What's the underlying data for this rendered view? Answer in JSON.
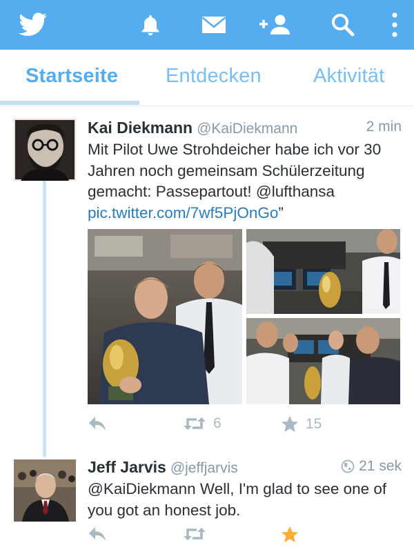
{
  "topbar": {
    "icons": [
      "twitter-bird-icon",
      "notifications-bell-icon",
      "messages-envelope-icon",
      "add-user-icon",
      "search-icon",
      "overflow-menu-icon"
    ],
    "color": "#55acee"
  },
  "tabs": [
    {
      "label": "Startseite",
      "active": true
    },
    {
      "label": "Entdecken",
      "active": false
    },
    {
      "label": "Aktivität",
      "active": false
    }
  ],
  "tweets": [
    {
      "name": "Kai Diekmann",
      "handle": "@KaiDiekmann",
      "time": "2 min",
      "text_lines": [
        "Mit Pilot Uwe Strohdeicher habe ich vor 30",
        "Jahren noch gemeinsam Schülerzeitung",
        "gemacht: Passepartout!  @lufthansa"
      ],
      "link": "pic.twitter.com/7wf5PjOnGo",
      "link_suffix": "”",
      "retweets": "6",
      "favorites": "15",
      "favorited": false
    },
    {
      "name": "Jeff Jarvis",
      "handle": "@jeffjarvis",
      "time": "21 sek",
      "text_lines": [
        "@KaiDiekmann Well, I'm glad to see one of",
        "you got an honest job."
      ],
      "favorited": true
    }
  ],
  "colors": {
    "accent": "#55acee",
    "link": "#2b7bb9",
    "muted": "#aab8c2",
    "star": "#ffac33"
  }
}
